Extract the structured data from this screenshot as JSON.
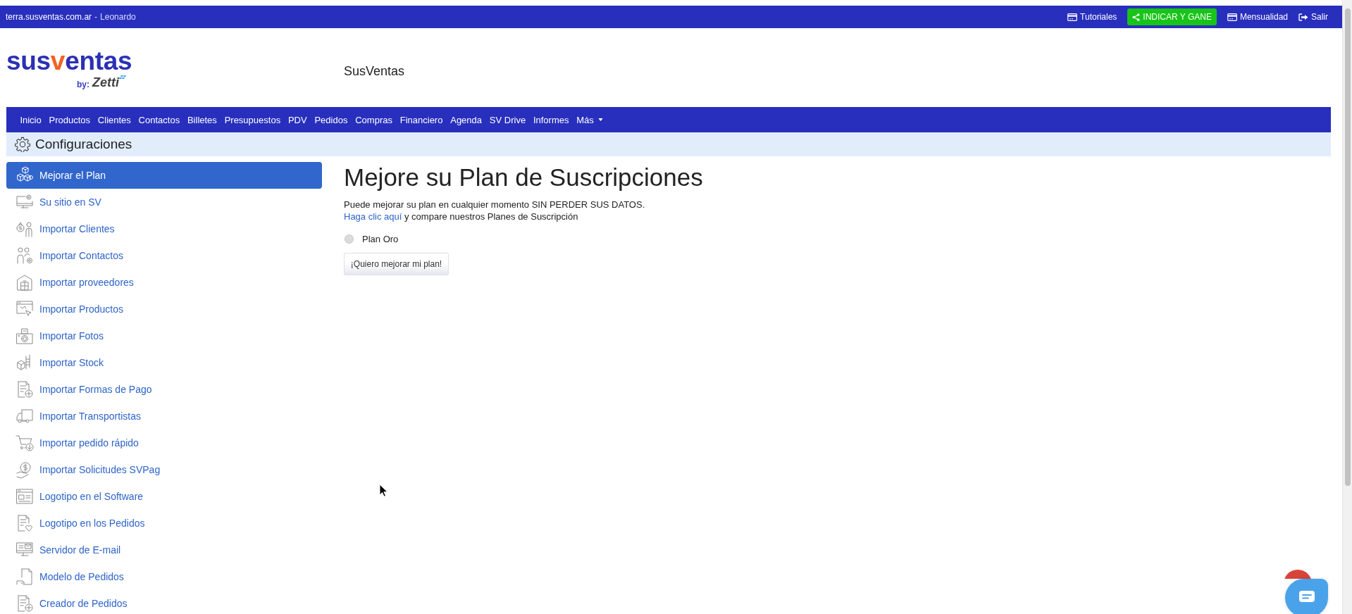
{
  "top_bar": {
    "site": "terra.susventas.com.ar",
    "separator": "-",
    "user": "Leonardo",
    "links": [
      {
        "kind": "link",
        "label": "Tutoriales"
      },
      {
        "kind": "button",
        "label": "INDICAR Y GANE"
      },
      {
        "kind": "link",
        "label": "Mensualidad"
      },
      {
        "kind": "link",
        "label": "Salir"
      }
    ]
  },
  "header": {
    "logo": {
      "wordmark": [
        {
          "text": "sus",
          "accent": false
        },
        {
          "text": "v",
          "accent": true
        },
        {
          "text": "entas",
          "accent": false
        }
      ],
      "by": "by:",
      "brand": "Zetti"
    },
    "title": "SusVentas"
  },
  "nav": {
    "items": [
      {
        "label": "Inicio",
        "dropdown": false
      },
      {
        "label": "Productos",
        "dropdown": false
      },
      {
        "label": "Clientes",
        "dropdown": false
      },
      {
        "label": "Contactos",
        "dropdown": false
      },
      {
        "label": "Billetes",
        "dropdown": false
      },
      {
        "label": "Presupuestos",
        "dropdown": false
      },
      {
        "label": "PDV",
        "dropdown": false
      },
      {
        "label": "Pedidos",
        "dropdown": false
      },
      {
        "label": "Compras",
        "dropdown": false
      },
      {
        "label": "Financiero",
        "dropdown": false
      },
      {
        "label": "Agenda",
        "dropdown": false
      },
      {
        "label": "SV Drive",
        "dropdown": false
      },
      {
        "label": "Informes",
        "dropdown": false
      },
      {
        "label": "Más",
        "dropdown": true
      }
    ]
  },
  "section": {
    "title": "Configuraciones"
  },
  "sidebar": {
    "items": [
      {
        "label": "Mejorar el Plan",
        "selected": true
      },
      {
        "label": "Su sitio en SV",
        "selected": false
      },
      {
        "label": "Importar Clientes",
        "selected": false
      },
      {
        "label": "Importar Contactos",
        "selected": false
      },
      {
        "label": "Importar proveedores",
        "selected": false
      },
      {
        "label": "Importar Productos",
        "selected": false
      },
      {
        "label": "Importar Fotos",
        "selected": false
      },
      {
        "label": "Importar Stock",
        "selected": false
      },
      {
        "label": "Importar Formas de Pago",
        "selected": false
      },
      {
        "label": "Importar Transportistas",
        "selected": false
      },
      {
        "label": "Importar pedido rápido",
        "selected": false
      },
      {
        "label": "Importar Solicitudes SVPag",
        "selected": false
      },
      {
        "label": "Logotipo en el Software",
        "selected": false
      },
      {
        "label": "Logotipo en los Pedidos",
        "selected": false
      },
      {
        "label": "Servidor de E-mail",
        "selected": false
      },
      {
        "label": "Modelo de Pedidos",
        "selected": false
      },
      {
        "label": "Creador de Pedidos",
        "selected": false
      }
    ]
  },
  "main": {
    "title": "Mejore su Plan de Suscripciones",
    "intro": "Puede mejorar su plan en cualquier momento SIN PERDER SUS DATOS.",
    "compare": {
      "link": "Haga clic aquí",
      "text": "y compare nuestros Planes de Suscripción"
    },
    "plans": [
      {
        "label": "Plan Oro",
        "selected": false,
        "disabled": true
      }
    ],
    "button": "¡Quiero mejorar mi plan!"
  }
}
